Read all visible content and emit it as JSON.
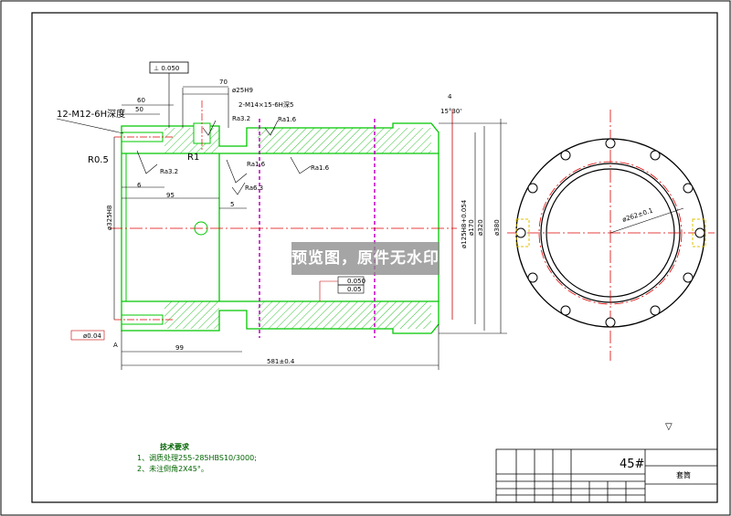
{
  "watermark": "预览图，原件无水印",
  "callouts": {
    "thread": "12-M12-6H深度",
    "radius_05": "R0.5",
    "radius_1": "R1",
    "perp_tol": "⊥ 0.050",
    "datum": "A"
  },
  "dimensions": {
    "d60": "60",
    "d50": "50",
    "d70": "70",
    "d25": "ø25H9",
    "thread_hole": "2-M14×15-6H深5",
    "d4": "4",
    "d15deg": "15°30'",
    "d6": "6",
    "d95": "95",
    "d5": "5",
    "d99": "99",
    "total": "581±0.4",
    "dia_left": "ø325H8",
    "dia_bore": "ø125H8+0.054",
    "dia_170": "ø170",
    "dia_320": "ø320",
    "dia_380": "ø380",
    "pcd": "ø262±0.1"
  },
  "roughness": {
    "r1": "Ra3.2",
    "r2": "Ra3.2",
    "r3": "Ra1.6",
    "r4": "Ra1.6",
    "r5": "Ra1.6",
    "r6": "Ra6.3"
  },
  "tolerances": {
    "flat": "0.050",
    "runout": "0.05",
    "coax": "ø0.04"
  },
  "tech_notes": {
    "title": "技术要求",
    "item1": "1、调质处理255-285HBS10/3000;",
    "item2": "2、未注倒角2X45°。"
  },
  "title_block": {
    "material": "45#",
    "name": "套筒",
    "mark": "▽"
  },
  "colors": {
    "frame": "#000000",
    "outline": "#00c800",
    "hatch": "#00b400",
    "centerline": "#e00000",
    "dimension": "#000000",
    "bore_note": "#c80000"
  }
}
